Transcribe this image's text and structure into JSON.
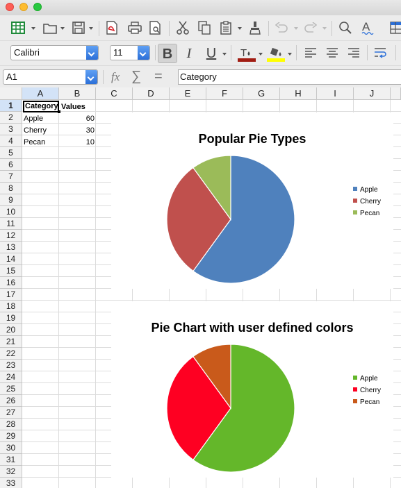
{
  "formula_bar": {
    "cell_ref": "A1",
    "content": "Category",
    "fx_symbol": "fx",
    "sum_symbol": "∑",
    "equals_symbol": "="
  },
  "format_bar": {
    "font_name": "Calibri",
    "font_size": "11",
    "bold": "B",
    "italic": "I",
    "underline": "U"
  },
  "sheet": {
    "columns": [
      "A",
      "B",
      "C",
      "D",
      "E",
      "F",
      "G",
      "H",
      "I",
      "J"
    ],
    "rows": [
      "1",
      "2",
      "3",
      "4",
      "5",
      "6",
      "7",
      "8",
      "9",
      "10",
      "11",
      "12",
      "13",
      "14",
      "15",
      "16",
      "17",
      "18",
      "19",
      "20",
      "21",
      "22",
      "23",
      "24",
      "25",
      "26",
      "27",
      "28",
      "29",
      "30",
      "31",
      "32",
      "33"
    ],
    "cells": {
      "a1": "Category",
      "b1": "Values",
      "a2": "Apple",
      "b2": "60",
      "a3": "Cherry",
      "b3": "30",
      "a4": "Pecan",
      "b4": "10"
    }
  },
  "chart_data": [
    {
      "type": "pie",
      "title": "Popular Pie Types",
      "categories": [
        "Apple",
        "Cherry",
        "Pecan"
      ],
      "values": [
        60,
        30,
        10
      ],
      "colors": [
        "#4f81bd",
        "#c0504d",
        "#9bbb59"
      ],
      "legend": "right"
    },
    {
      "type": "pie",
      "title": "Pie Chart with user defined colors",
      "categories": [
        "Apple",
        "Cherry",
        "Pecan"
      ],
      "values": [
        60,
        30,
        10
      ],
      "colors": [
        "#64b72a",
        "#fe0022",
        "#c95a1b"
      ],
      "legend": "right"
    }
  ],
  "colors": {
    "selection": "#d3e3f7",
    "accent": "#2b6fd8"
  }
}
